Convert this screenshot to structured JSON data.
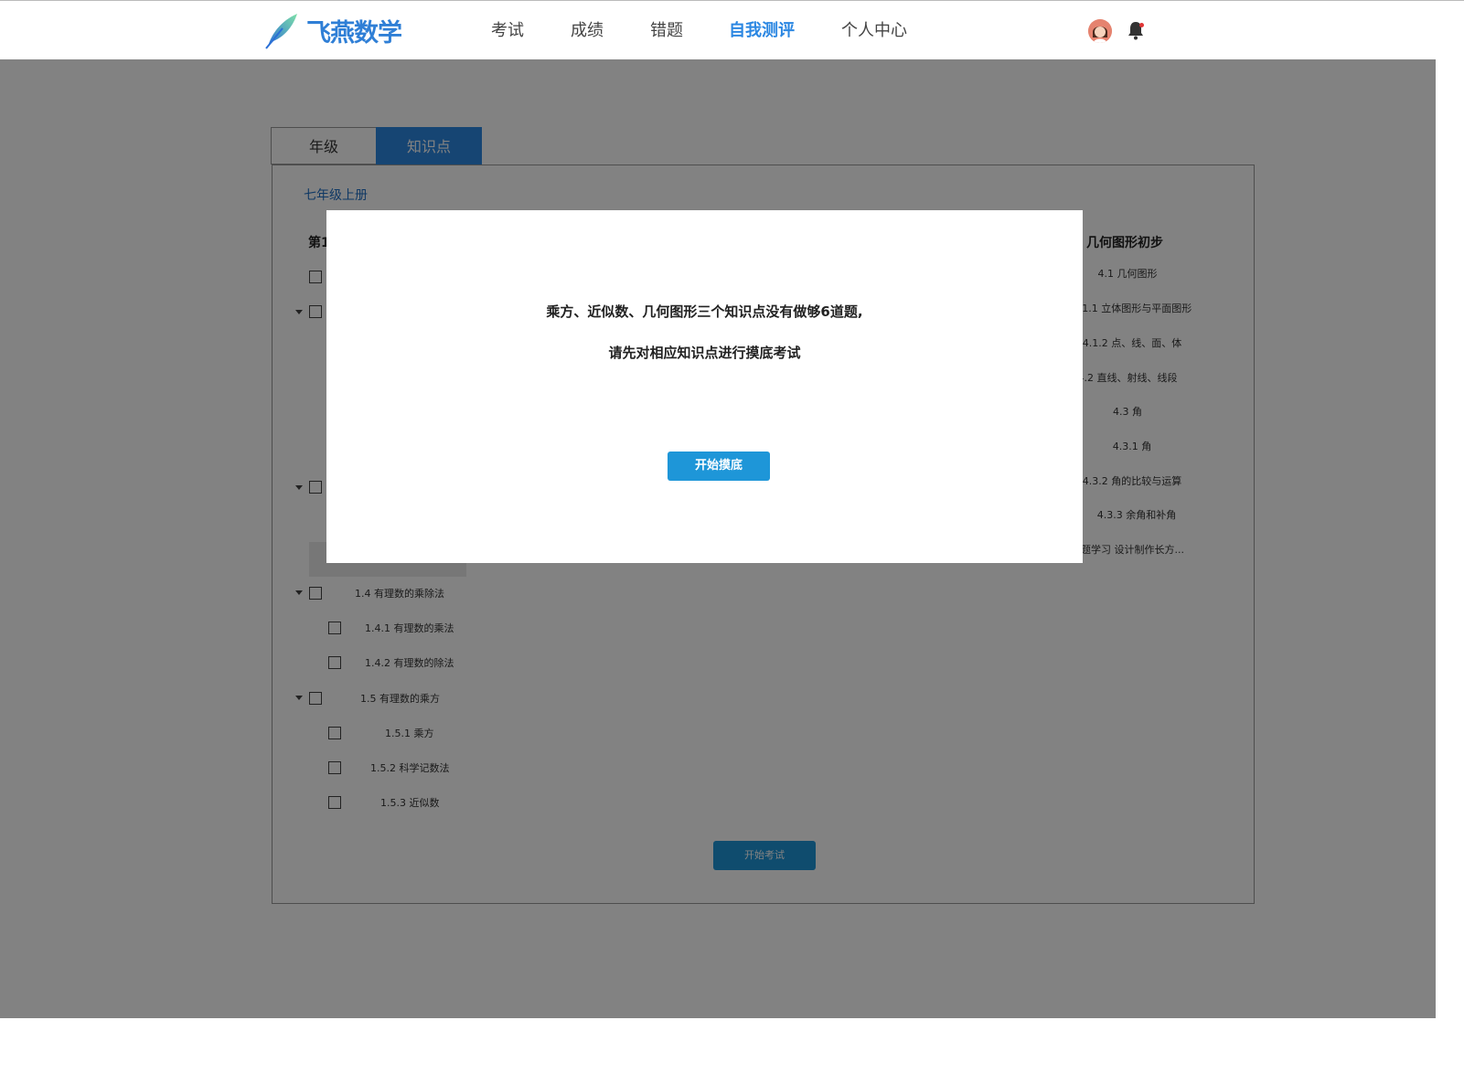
{
  "header": {
    "logo_text": "飞燕数学",
    "nav": [
      "考试",
      "成绩",
      "错题",
      "自我测评",
      "个人中心"
    ],
    "active_nav": "自我测评",
    "accent_color": "#2b87e2"
  },
  "tabs": {
    "grade": "年级",
    "knowledge_point": "知识点"
  },
  "panel": {
    "semester": "七年级上册",
    "left_chapter_title": "第1",
    "left_items": {
      "item_1_4": "1.4 有理数的乘除法",
      "item_1_4_1": "1.4.1 有理数的乘法",
      "item_1_4_2": "1.4.2 有理数的除法",
      "item_1_5": "1.5 有理数的乘方",
      "item_1_5_1": "1.5.1 乘方",
      "item_1_5_2": "1.5.2 科学记数法",
      "item_1_5_3": "1.5.3 近似数"
    },
    "right_chapter_title": "几何图形初步",
    "right_items": [
      "4.1 几何图形",
      "4.1.1 立体图形与平面图形",
      "4.1.2 点、线、面、体",
      "4.2 直线、射线、线段",
      "4.3 角",
      "4.3.1 角",
      "4.3.2 角的比较与运算",
      "4.3.3 余角和补角",
      "课题学习 设计制作长方..."
    ],
    "start_exam_label": "开始考试"
  },
  "modal": {
    "line1": "乘方、近似数、几何图形三个知识点没有做够6道题,",
    "line2": "请先对相应知识点进行摸底考试",
    "button_label": "开始摸底"
  }
}
